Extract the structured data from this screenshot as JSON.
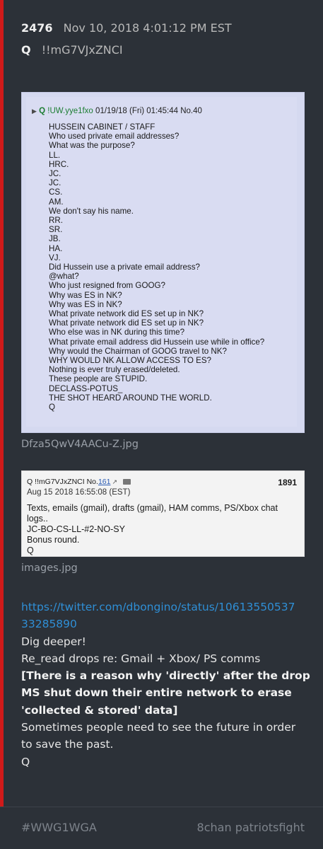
{
  "post": {
    "number": "2476",
    "date": "Nov 10, 2018 4:01:12 PM EST",
    "author": "Q",
    "tripcode": "!!mG7VJxZNCI"
  },
  "image1": {
    "header_arrow": "▶",
    "header_author": "Q",
    "header_trip": "!UW.yye1fxo",
    "header_meta": "01/19/18 (Fri) 01:45:44 No.40",
    "lines": [
      "HUSSEIN CABINET / STAFF",
      "Who used private email addresses?",
      "What was the purpose?",
      "LL.",
      "HRC.",
      "JC.",
      "JC.",
      "CS.",
      "AM.",
      "We don't say his name.",
      "RR.",
      "SR.",
      "JB.",
      "HA.",
      "VJ.",
      "Did Hussein use a private email address?",
      "@what?",
      "Who just resigned from GOOG?",
      "Why was ES in NK?",
      "Why was ES in NK?",
      "What private network did ES set up in NK?",
      "What private network did ES set up in NK?",
      "Who else was in NK during this time?",
      "What private email address did Hussein use while in office?",
      "Why would the Chairman of GOOG travel to NK?",
      "WHY WOULD NK ALLOW ACCESS TO ES?",
      "Nothing is ever truly erased/deleted.",
      "These people are STUPID.",
      "DECLASS-POTUS_",
      "THE SHOT HEARD AROUND THE WORLD.",
      "Q"
    ],
    "caption": "Dfza5QwV4AACu-Z.jpg"
  },
  "image2": {
    "header_author": "Q !!mG7VJxZNCI No.",
    "header_link": "161",
    "header_link_icon": "↗",
    "number": "1891",
    "date": "Aug 15 2018 16:55:08 (EST)",
    "lines": [
      "Texts, emails (gmail), drafts (gmail), HAM comms, PS/Xbox chat",
      "logs..",
      "JC-BO-CS-LL-#2-NO-SY",
      "Bonus round.",
      "Q"
    ],
    "caption": "images.jpg"
  },
  "body": {
    "link_line1": "https://twitter.com/dbongino/status/10613550537",
    "link_line2": "33285890",
    "line1": "Dig deeper!",
    "line2": "Re_read drops re: Gmail + Xbox/ PS comms",
    "bold1": "[There is a reason why 'directly' after the drop",
    "bold2": "MS shut down their entire network to erase",
    "bold3": "'collected & stored' data]",
    "line3": "Sometimes people need to see the future in order",
    "line4": "to save the past.",
    "sign": "Q"
  },
  "footer": {
    "hashtag": "#WWG1WGA",
    "source": "8chan patriotsfight"
  },
  "colors": {
    "background": "#2c3138",
    "accent_bar": "#d01a1a",
    "link": "#2f8fd6"
  }
}
